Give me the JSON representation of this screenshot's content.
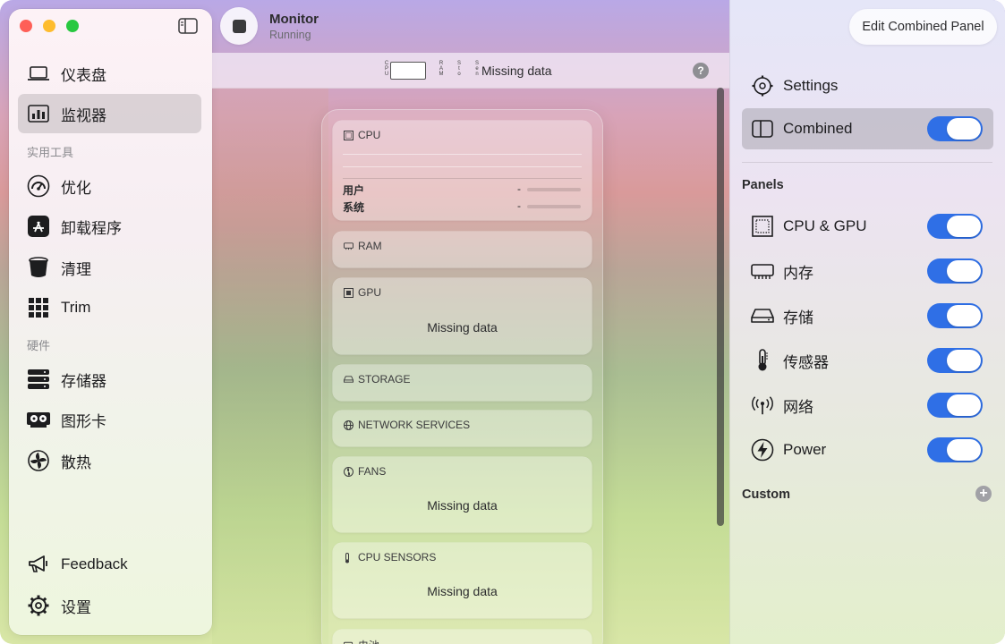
{
  "sidebar": {
    "items": [
      {
        "label": "仪表盘",
        "icon": "laptop-icon"
      },
      {
        "label": "监视器",
        "icon": "chart-bars-icon",
        "selected": true
      }
    ],
    "section_utilities": "实用工具",
    "utilities": [
      {
        "label": "优化",
        "icon": "speedometer-icon"
      },
      {
        "label": "卸载程序",
        "icon": "app-store-icon"
      },
      {
        "label": "清理",
        "icon": "trash-bin-icon"
      },
      {
        "label": "Trim",
        "icon": "grid-icon"
      }
    ],
    "section_hardware": "硬件",
    "hardware": [
      {
        "label": "存储器",
        "icon": "storage-icon"
      },
      {
        "label": "图形卡",
        "icon": "graphics-card-icon"
      },
      {
        "label": "散热",
        "icon": "fan-icon"
      }
    ],
    "footer": [
      {
        "label": "Feedback",
        "icon": "megaphone-icon"
      },
      {
        "label": "设置",
        "icon": "gear-icon"
      }
    ]
  },
  "toolbar": {
    "title": "Monitor",
    "status": "Running"
  },
  "statusbar": {
    "labels": [
      "CPU",
      "RAM",
      "Sto",
      "Sen"
    ],
    "text": "Missing data",
    "help": "?"
  },
  "preview": {
    "cpu": {
      "title": "CPU",
      "rows": [
        {
          "label": "用户",
          "value": "-"
        },
        {
          "label": "系统",
          "value": "-"
        }
      ]
    },
    "ram": {
      "title": "RAM"
    },
    "gpu": {
      "title": "GPU",
      "message": "Missing data"
    },
    "storage": {
      "title": "STORAGE"
    },
    "network": {
      "title": "NETWORK SERVICES"
    },
    "fans": {
      "title": "FANS",
      "message": "Missing data"
    },
    "sensors": {
      "title": "CPU SENSORS",
      "message": "Missing data"
    },
    "battery": {
      "title": "电池"
    }
  },
  "inspector": {
    "title": "Edit Combined Panel",
    "settings": "Settings",
    "combined": {
      "label": "Combined",
      "on": true
    },
    "panels_heading": "Panels",
    "panels": [
      {
        "label": "CPU & GPU",
        "icon": "cpu-chip-icon",
        "on": true
      },
      {
        "label": "内存",
        "icon": "memory-icon",
        "on": true
      },
      {
        "label": "存储",
        "icon": "drive-icon",
        "on": true
      },
      {
        "label": "传感器",
        "icon": "thermometer-icon",
        "on": true
      },
      {
        "label": "网络",
        "icon": "antenna-icon",
        "on": true
      },
      {
        "label": "Power",
        "icon": "bolt-icon",
        "on": true
      }
    ],
    "custom_heading": "Custom",
    "add_label": "+"
  },
  "colors": {
    "accent": "#2f6fe6",
    "traffic_red": "#fe5f57",
    "traffic_yellow": "#febc2e",
    "traffic_green": "#28c840"
  }
}
